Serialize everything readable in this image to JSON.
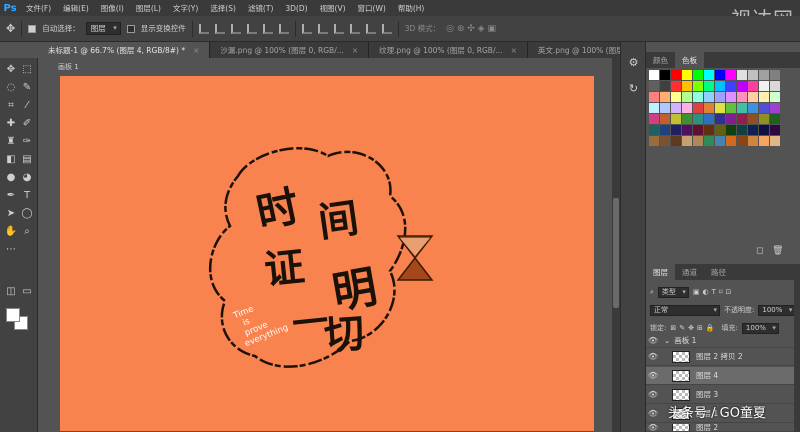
{
  "app": {
    "logo": "Ps",
    "brand_watermark": "视达网"
  },
  "menu": [
    "文件(F)",
    "编辑(E)",
    "图像(I)",
    "图层(L)",
    "文字(Y)",
    "选择(S)",
    "滤镜(T)",
    "3D(D)",
    "视图(V)",
    "窗口(W)",
    "帮助(H)"
  ],
  "options": {
    "auto_select_label": "自动选择：",
    "auto_select_value": "图层",
    "show_transform_label": "显示变换控件",
    "mode_3d": "3D 模式："
  },
  "tabs": [
    {
      "label": "未标题-1 @ 66.7% (图层 4, RGB/8#) *",
      "active": true
    },
    {
      "label": "沙漏.png @ 100% (图层 0, RGB/...",
      "active": false
    },
    {
      "label": "纹理.png @ 100% (图层 0, RGB/...",
      "active": false
    },
    {
      "label": "英文.png @ 100% (图层 0, RGB/...",
      "active": false
    }
  ],
  "canvas": {
    "doc_label": "画板 1",
    "background": "#f9834f",
    "chars": [
      "时",
      "间",
      "证",
      "明",
      "一",
      "切"
    ],
    "english": [
      "Time",
      "is",
      "prove",
      "everything"
    ]
  },
  "swatch_panel": {
    "tabs": [
      "颜色",
      "色板"
    ],
    "colors": [
      "#ffffff",
      "#000000",
      "#ff0000",
      "#ffff00",
      "#00ff00",
      "#00ffff",
      "#0000ff",
      "#ff00ff",
      "#e0e0e0",
      "#c0c0c0",
      "#a0a0a0",
      "#808080",
      "#606060",
      "#404040",
      "#ff3030",
      "#ffc000",
      "#80ff00",
      "#00ff80",
      "#00c0ff",
      "#4040ff",
      "#c000ff",
      "#ff40a0",
      "#f0f0f0",
      "#d8d8d8",
      "#ff8080",
      "#ffb070",
      "#ffff90",
      "#b0ff90",
      "#90ffe0",
      "#90d0ff",
      "#a0a0ff",
      "#e090ff",
      "#ff90c0",
      "#ffd0a0",
      "#fff0b0",
      "#d0ffd0",
      "#c0f0ff",
      "#b0c8ff",
      "#d0b0ff",
      "#ffb0e0",
      "#e04040",
      "#e08030",
      "#e0e040",
      "#60c040",
      "#40c0a0",
      "#4090e0",
      "#5050d0",
      "#a040d0",
      "#d04080",
      "#c06030",
      "#c0c030",
      "#409030",
      "#309080",
      "#3070c0",
      "#303090",
      "#802090",
      "#902050",
      "#905020",
      "#909020",
      "#206020",
      "#206060",
      "#204080",
      "#202060",
      "#501060",
      "#601030",
      "#603010",
      "#606010",
      "#104010",
      "#104040",
      "#102050",
      "#101040",
      "#300840",
      "#9b6b3a",
      "#7a5230",
      "#5a3a20",
      "#c8a070",
      "#b08858",
      "#2e8b57",
      "#4682b4",
      "#d2691e",
      "#8b4513",
      "#cd853f",
      "#f4a460",
      "#deb887"
    ]
  },
  "layers_panel": {
    "tabs": [
      "图层",
      "通道",
      "路径"
    ],
    "filter_label": "类型",
    "blend_mode": "正常",
    "opacity_label": "不透明度:",
    "opacity_value": "100%",
    "lock_label": "锁定:",
    "fill_label": "填充:",
    "fill_value": "100%",
    "group_name": "画板 1",
    "layers": [
      {
        "name": "图层 2 拷贝 2",
        "selected": false
      },
      {
        "name": "图层 4",
        "selected": true
      },
      {
        "name": "图层 3",
        "selected": false
      },
      {
        "name": "图层 1",
        "selected": false
      },
      {
        "name": "图层 2",
        "selected": false
      }
    ]
  },
  "watermark": "头条号 / GO童夏"
}
